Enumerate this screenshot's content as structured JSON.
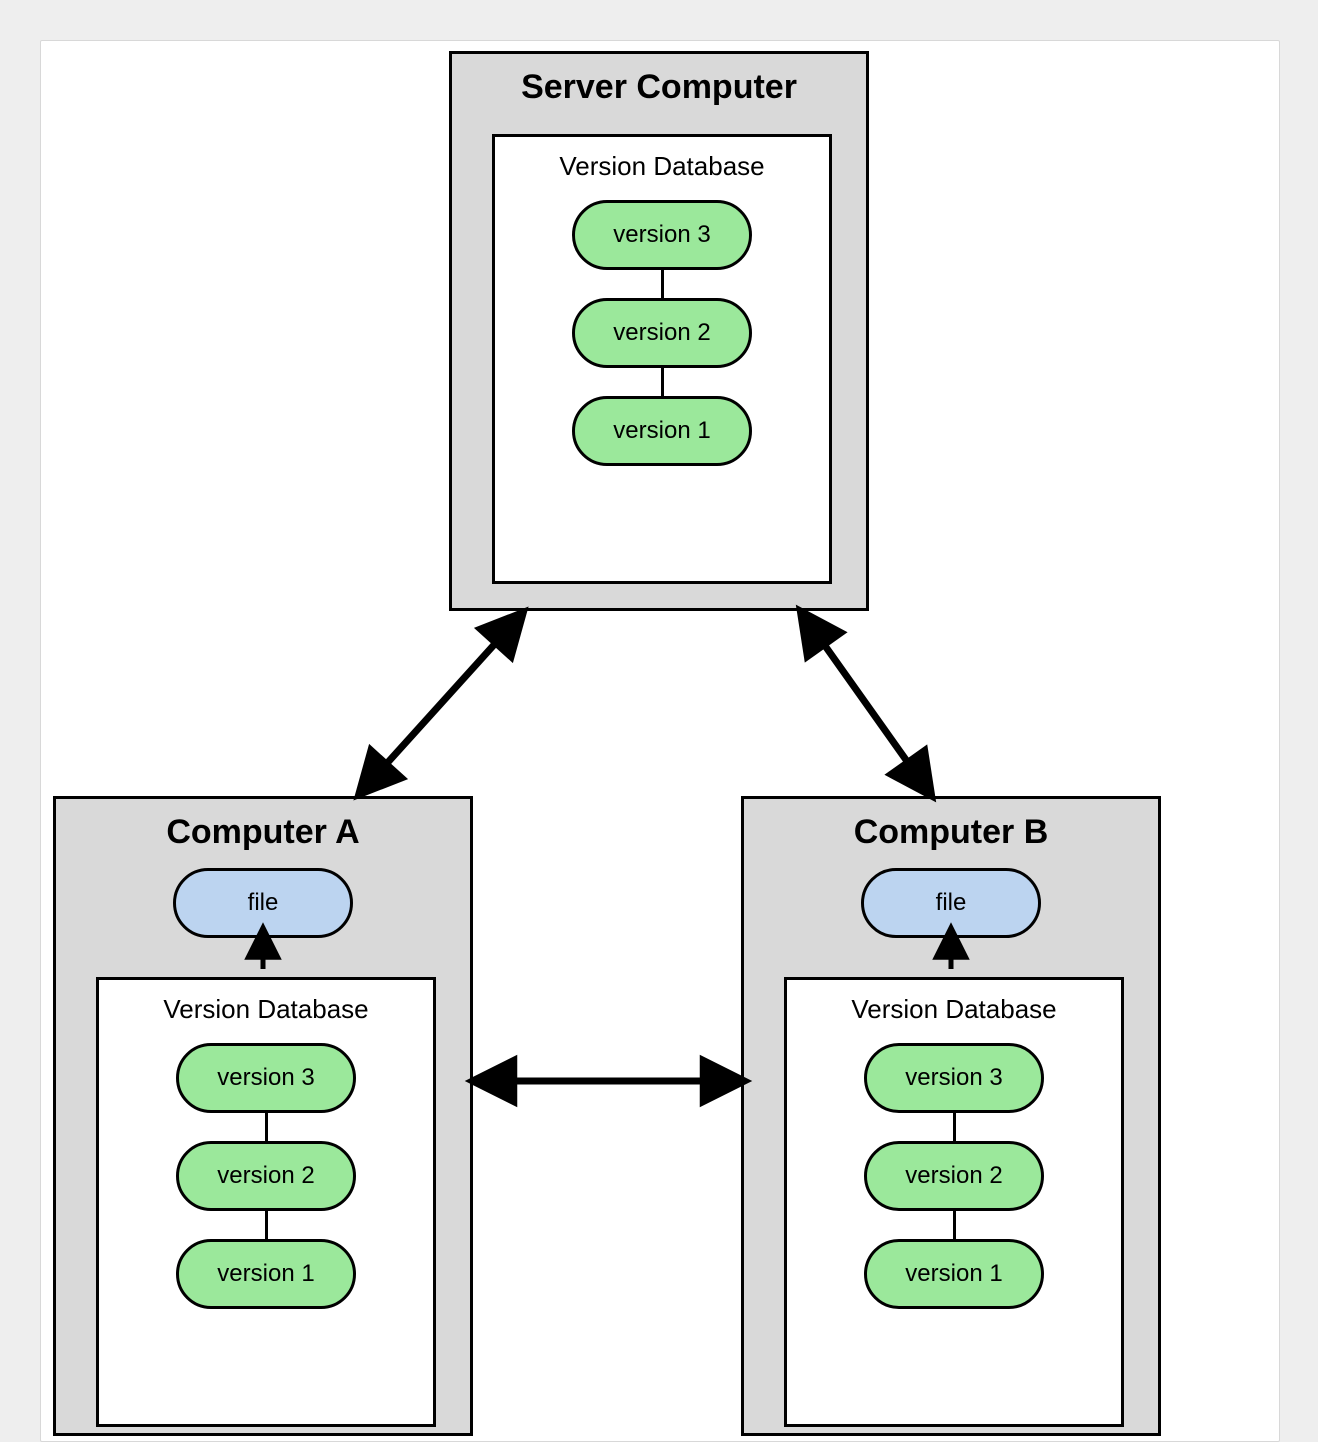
{
  "server": {
    "title": "Server Computer",
    "db_title": "Version Database",
    "versions": [
      "version 3",
      "version 2",
      "version 1"
    ]
  },
  "clientA": {
    "title": "Computer A",
    "file_label": "file",
    "db_title": "Version Database",
    "versions": [
      "version 3",
      "version 2",
      "version 1"
    ]
  },
  "clientB": {
    "title": "Computer B",
    "file_label": "file",
    "db_title": "Version Database",
    "versions": [
      "version 3",
      "version 2",
      "version 1"
    ]
  },
  "colors": {
    "version_fill": "#9be89b",
    "file_fill": "#bcd4f0",
    "box_fill": "#d9d9d9"
  }
}
